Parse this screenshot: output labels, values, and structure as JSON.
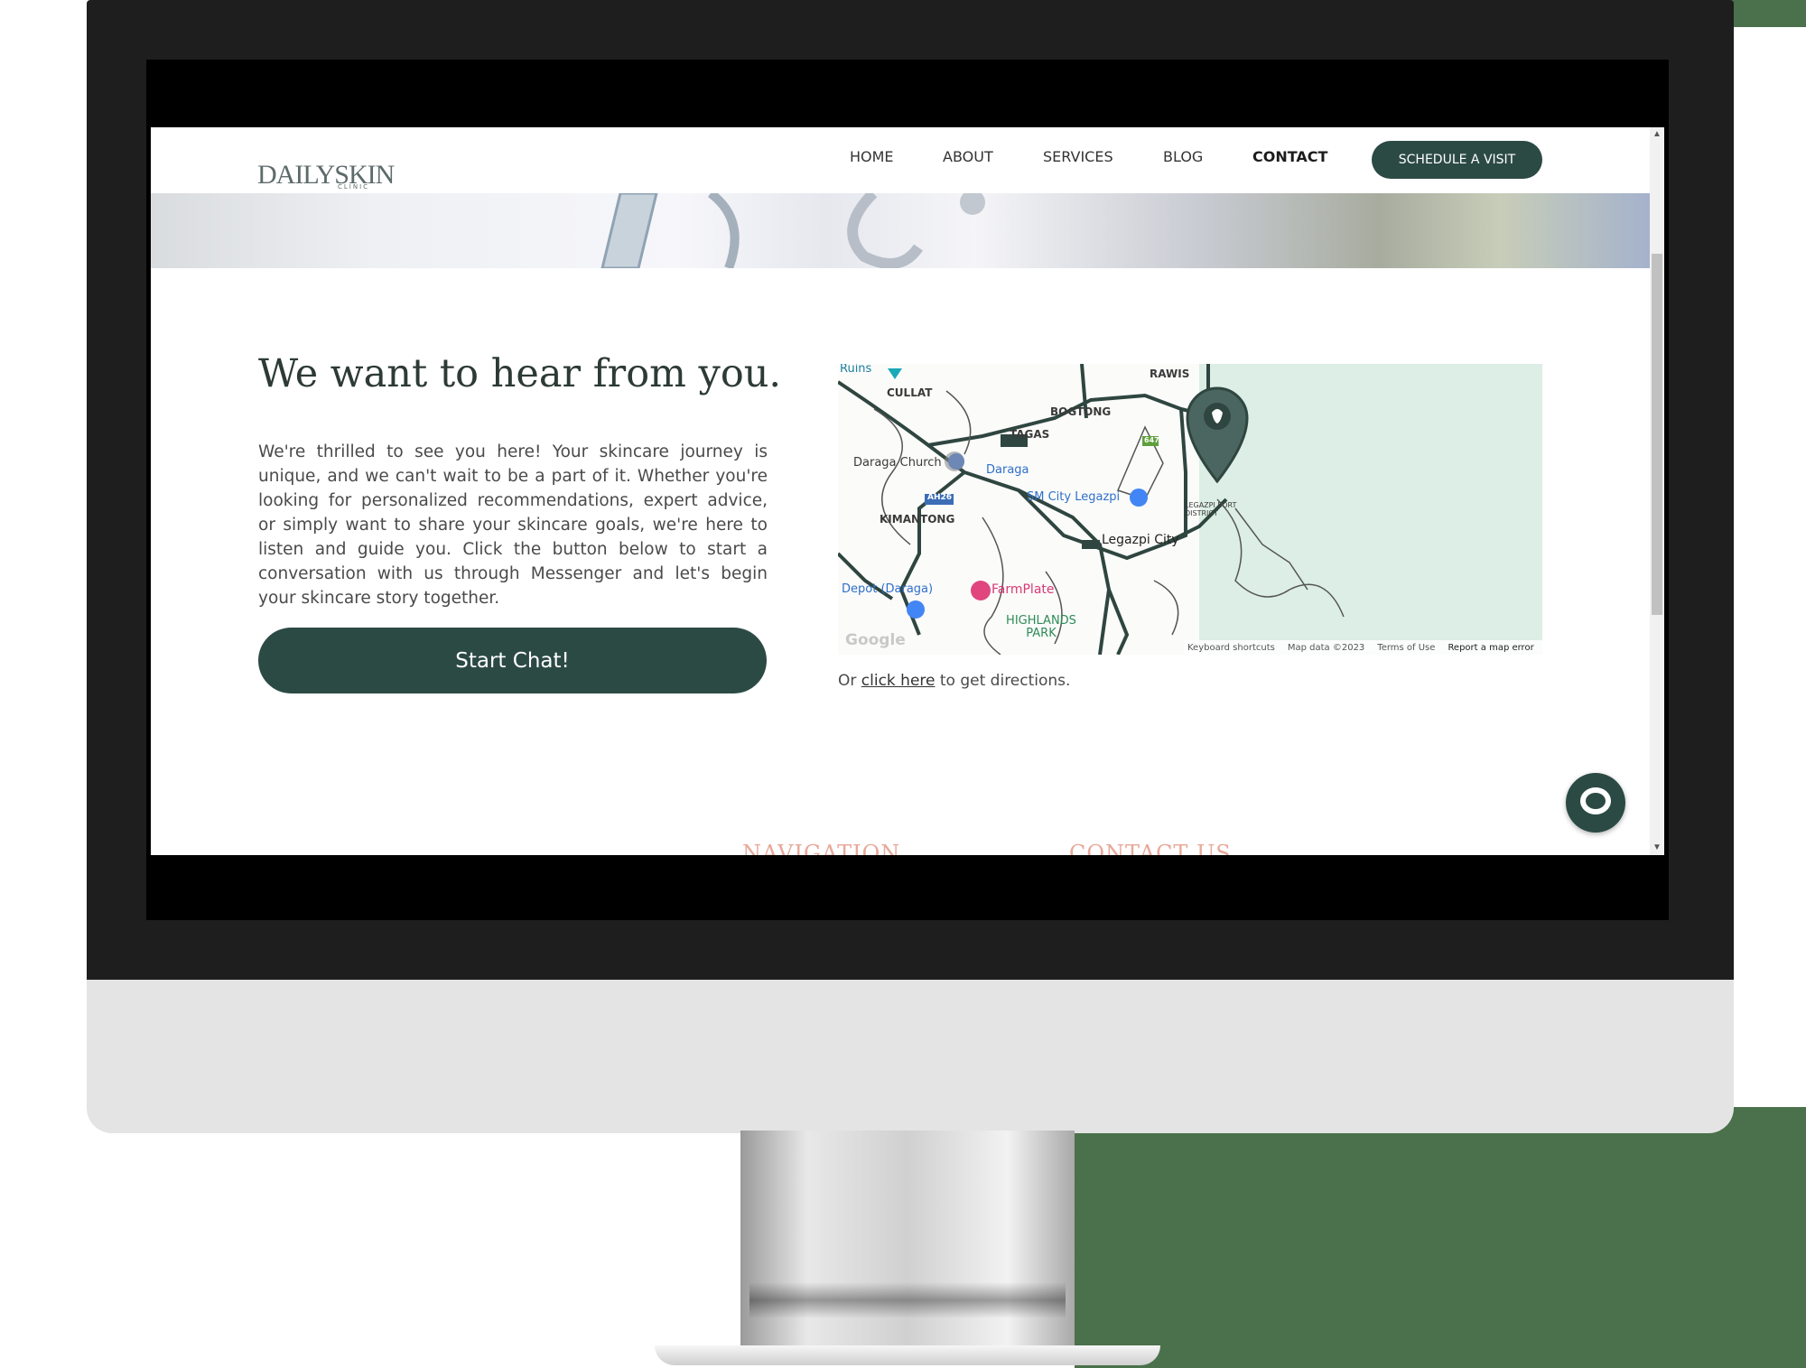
{
  "nav": {
    "logo_main": "DAILYSKIN",
    "logo_sub": "CLINIC",
    "links": [
      "HOME",
      "ABOUT",
      "SERVICES",
      "BLOG",
      "CONTACT"
    ],
    "cta": "SCHEDULE A VISIT"
  },
  "contact": {
    "heading": "We want to hear from you.",
    "body": "We're thrilled to see you here! Your skincare journey is unique, and we can't wait to be a part of it. Whether you're looking for personalized recommendations, expert advice, or simply want to share your skincare goals, we're here to listen and guide you. Click the button below to start a conversation with us through Messenger and let's begin your skincare story together.",
    "chat_button": "Start Chat!"
  },
  "map": {
    "labels": [
      "Ruins",
      "CULLAT",
      "RAWIS",
      "BOGTONG",
      "TAGAS",
      "Daraga Church",
      "Daraga",
      "SM City Legazpi",
      "KIMANTONG",
      "Legazpi City",
      "LEGAZPI PORT DISTRICT",
      "FarmPlate",
      "Depot (Daraga)",
      "HIGHLANDS PARK",
      "AH26",
      "647"
    ],
    "google": "Google",
    "footer": [
      "Keyboard shortcuts",
      "Map data ©2023",
      "Terms of Use",
      "Report a map error"
    ]
  },
  "directions": {
    "prefix": "Or",
    "link": "click here",
    "suffix": "to get directions."
  },
  "footer": {
    "navigation": "NAVIGATION",
    "contact_us": "CONTACT US"
  },
  "colors": {
    "brand": "#2c4a44",
    "accent_footer": "#e8a899"
  }
}
